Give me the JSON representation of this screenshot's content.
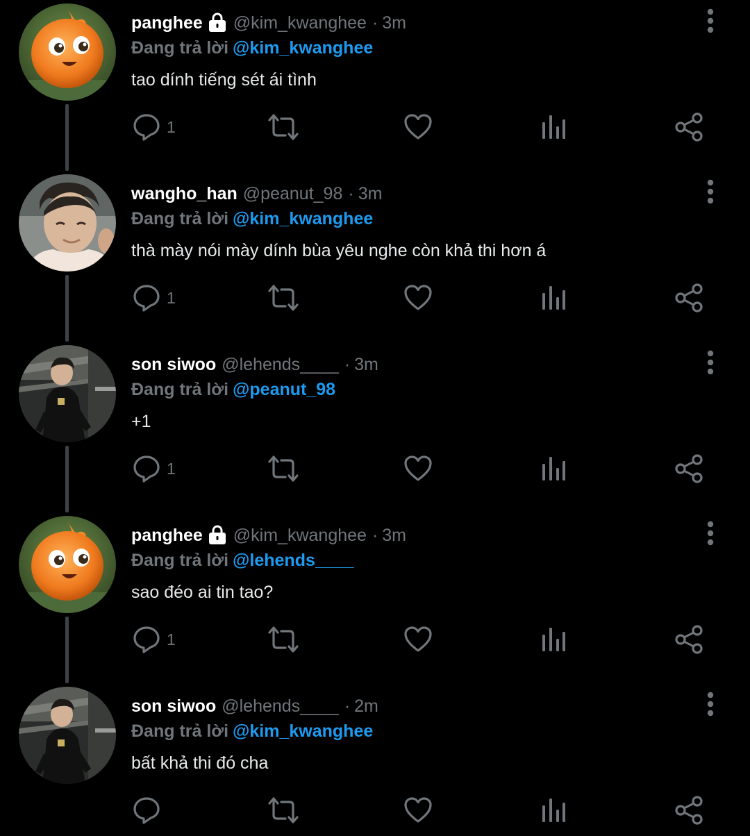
{
  "colors": {
    "background": "#000000",
    "name": "#ffffff",
    "muted": "#71767b",
    "mention": "#1d9bf0",
    "text": "#e7e9ea",
    "connector": "#3d4148"
  },
  "reply_prefix": "Đang trả lời",
  "tweets": [
    {
      "display_name": "panghee",
      "protected": true,
      "handle": "@kim_kwanghee",
      "separator": "·",
      "time": "3m",
      "reply_to": "@kim_kwanghee",
      "text": "tao dính tiếng sét ái tình",
      "reply_count": "1",
      "avatar": "orange-creature-avatar"
    },
    {
      "display_name": "wangho_han",
      "protected": false,
      "handle": "@peanut_98",
      "separator": "·",
      "time": "3m",
      "reply_to": "@kim_kwanghee",
      "text": "thà mày nói mày dính bùa yêu nghe còn khả thi hơn á",
      "reply_count": "1",
      "avatar": "person-photo-avatar"
    },
    {
      "display_name": "son siwoo",
      "protected": false,
      "handle": "@lehends____",
      "separator": "·",
      "time": "3m",
      "reply_to": "@peanut_98",
      "text": "+1",
      "reply_count": "1",
      "avatar": "person-dark-photo-avatar"
    },
    {
      "display_name": "panghee",
      "protected": true,
      "handle": "@kim_kwanghee",
      "separator": "·",
      "time": "3m",
      "reply_to": "@lehends____",
      "text": "sao đéo ai tin tao?",
      "reply_count": "1",
      "avatar": "orange-creature-avatar"
    },
    {
      "display_name": "son siwoo",
      "protected": false,
      "handle": "@lehends____",
      "separator": "·",
      "time": "2m",
      "reply_to": "@kim_kwanghee",
      "text": "bất khả thi đó cha",
      "reply_count": "",
      "avatar": "person-dark-photo-avatar"
    }
  ],
  "icons": {
    "reply": "reply-icon",
    "retweet": "retweet-icon",
    "like": "heart-icon",
    "views": "views-icon",
    "share": "share-icon",
    "more": "more-vertical-icon",
    "lock": "lock-icon"
  }
}
